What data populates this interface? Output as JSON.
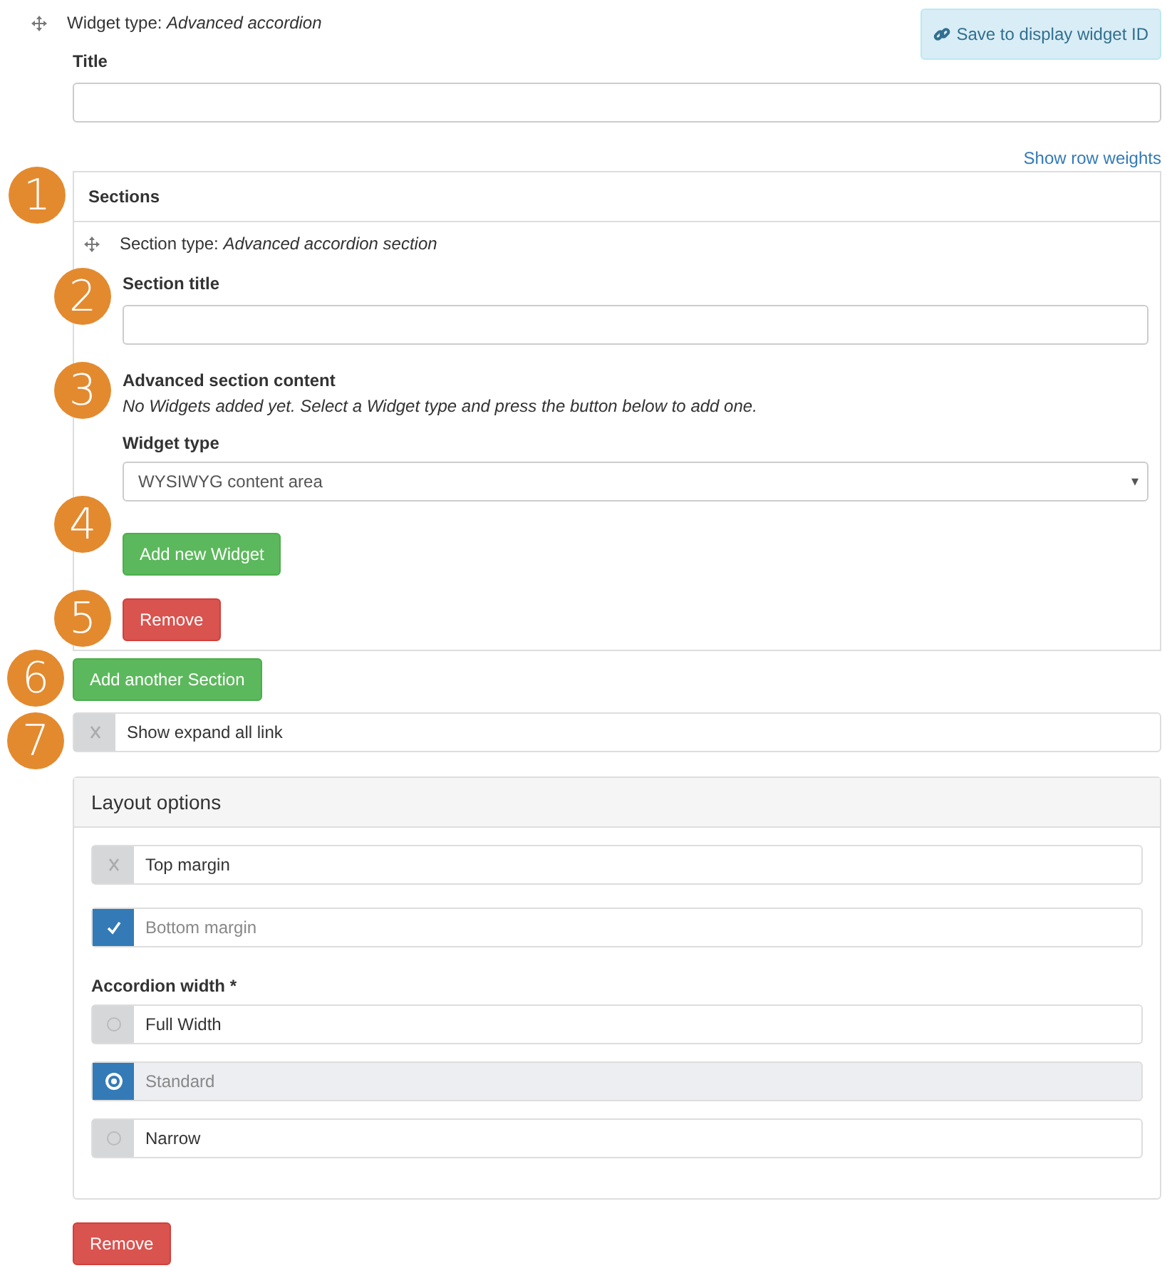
{
  "header": {
    "widget_type": "Widget type: *Advanced accordion*",
    "save_button": "Save to display widget ID"
  },
  "title_field": {
    "label": "Title"
  },
  "row_weights_link": "Show row weights",
  "sections": {
    "marker": "1",
    "heading": "Sections",
    "items": [
      {
        "type_line": "Section type: *Advanced accordion section*",
        "title_label": "Section title",
        "title_marker": "2",
        "content_heading": "Advanced section content",
        "content_marker": "3",
        "content_note": "No Widgets added yet. Select a Widget type and press the button below to add one.",
        "widget_type_label": "Widget type",
        "widget_type_value": "WYSIWYG content area",
        "widget_type_caret": "▾",
        "add_button": "Add new Widget",
        "add_marker": "4",
        "remove_button": "Remove",
        "remove_marker": "5"
      }
    ]
  },
  "add_section_button": {
    "label": "Add another Section",
    "marker": "6"
  },
  "expand_toggle": {
    "label": "Show expand all link",
    "checked": false,
    "marker": "7"
  },
  "layout_options": {
    "title": "Layout options",
    "toggles": [
      {
        "label": "Top margin",
        "checked": false
      },
      {
        "label": "Bottom margin",
        "checked": true
      }
    ],
    "width_label": "Accordion width *",
    "widths": [
      {
        "label": "Full Width",
        "selected": false
      },
      {
        "label": "Standard",
        "selected": true
      },
      {
        "label": "Narrow",
        "selected": false
      }
    ]
  },
  "remove_button": "Remove"
}
